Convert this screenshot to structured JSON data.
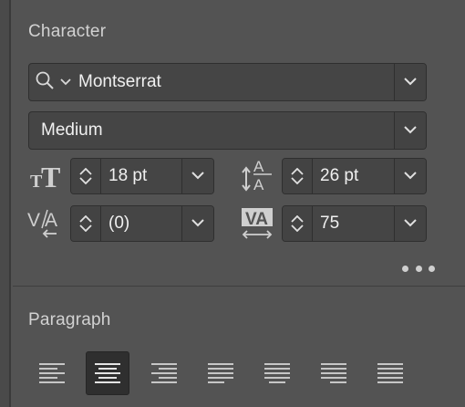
{
  "character": {
    "title": "Character",
    "font_family": {
      "value": "Montserrat",
      "icon": "search-icon"
    },
    "font_style": {
      "value": "Medium"
    },
    "font_size": {
      "value": "18 pt",
      "icon": "font-size-icon"
    },
    "leading": {
      "value": "26 pt",
      "icon": "leading-icon"
    },
    "kerning": {
      "value": "(0)",
      "icon": "kerning-icon"
    },
    "tracking": {
      "value": "75",
      "icon": "tracking-icon"
    },
    "more_icon": "more-options-icon"
  },
  "paragraph": {
    "title": "Paragraph",
    "alignment_options": [
      {
        "name": "align-left",
        "active": false
      },
      {
        "name": "align-center",
        "active": true
      },
      {
        "name": "align-right",
        "active": false
      },
      {
        "name": "justify-last-left",
        "active": false
      },
      {
        "name": "justify-last-center",
        "active": false
      },
      {
        "name": "justify-last-right",
        "active": false
      },
      {
        "name": "justify-all",
        "active": false
      }
    ]
  },
  "colors": {
    "panel_bg": "#535353",
    "field_bg": "#454545",
    "active_button_bg": "#2f2f2f",
    "text": "#f0f0f0"
  }
}
